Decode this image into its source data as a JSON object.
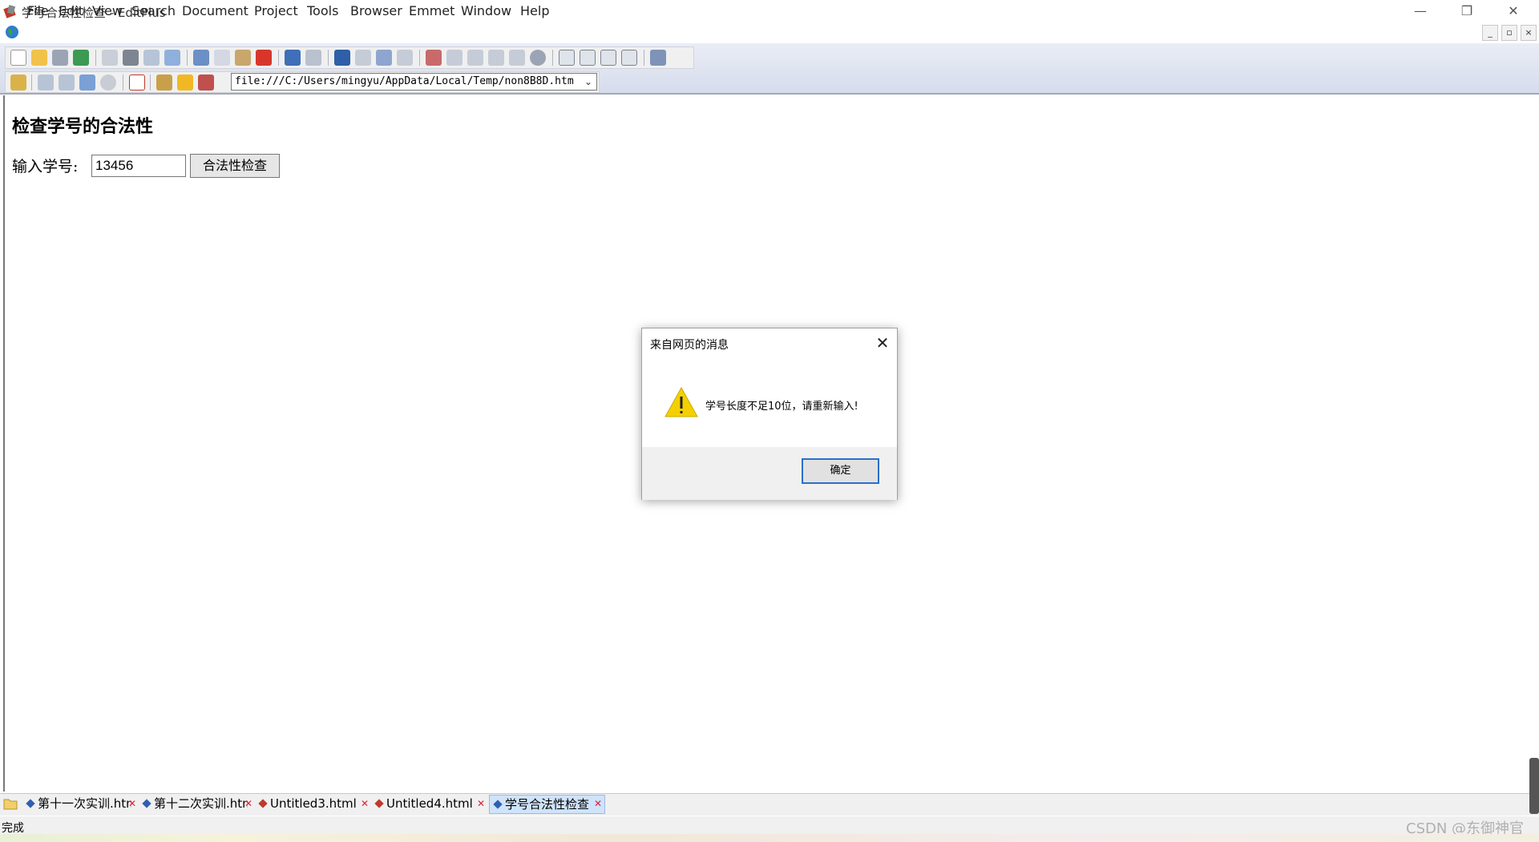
{
  "window": {
    "title": "学号合法性检查 - EditPlus",
    "minimize": "—",
    "restore": "❐",
    "close": "✕"
  },
  "menu": {
    "items": [
      "File",
      "Edit",
      "View",
      "Search",
      "Document",
      "Project",
      "Tools",
      "Browser",
      "Emmet",
      "Window",
      "Help"
    ],
    "mdi_buttons": [
      "_",
      "▫",
      "×"
    ]
  },
  "browser_bar": {
    "url": "file:///C:/Users/mingyu/AppData/Local/Temp/non8B8D.htm",
    "dropdown": "⌄"
  },
  "page": {
    "heading": "检查学号的合法性",
    "input_label": "输入学号:",
    "input_value": "13456",
    "button_label": "合法性检查"
  },
  "dialog": {
    "title": "来自网页的消息",
    "close": "✕",
    "message": "学号长度不足10位，请重新输入!",
    "ok": "确定"
  },
  "tabs": [
    {
      "label": "第十一次实训.htm",
      "active": false
    },
    {
      "label": "第十二次实训.htm",
      "active": false
    },
    {
      "label": "Untitled3.html",
      "active": false
    },
    {
      "label": "Untitled4.html",
      "active": false
    },
    {
      "label": "学号合法性检查",
      "active": true
    }
  ],
  "status": {
    "text": "完成",
    "watermark": "CSDN @东御神官"
  },
  "colors": {
    "accent": "#2a6fc9",
    "tab_active": "#cfe3fa",
    "warning": "#f5d000"
  }
}
